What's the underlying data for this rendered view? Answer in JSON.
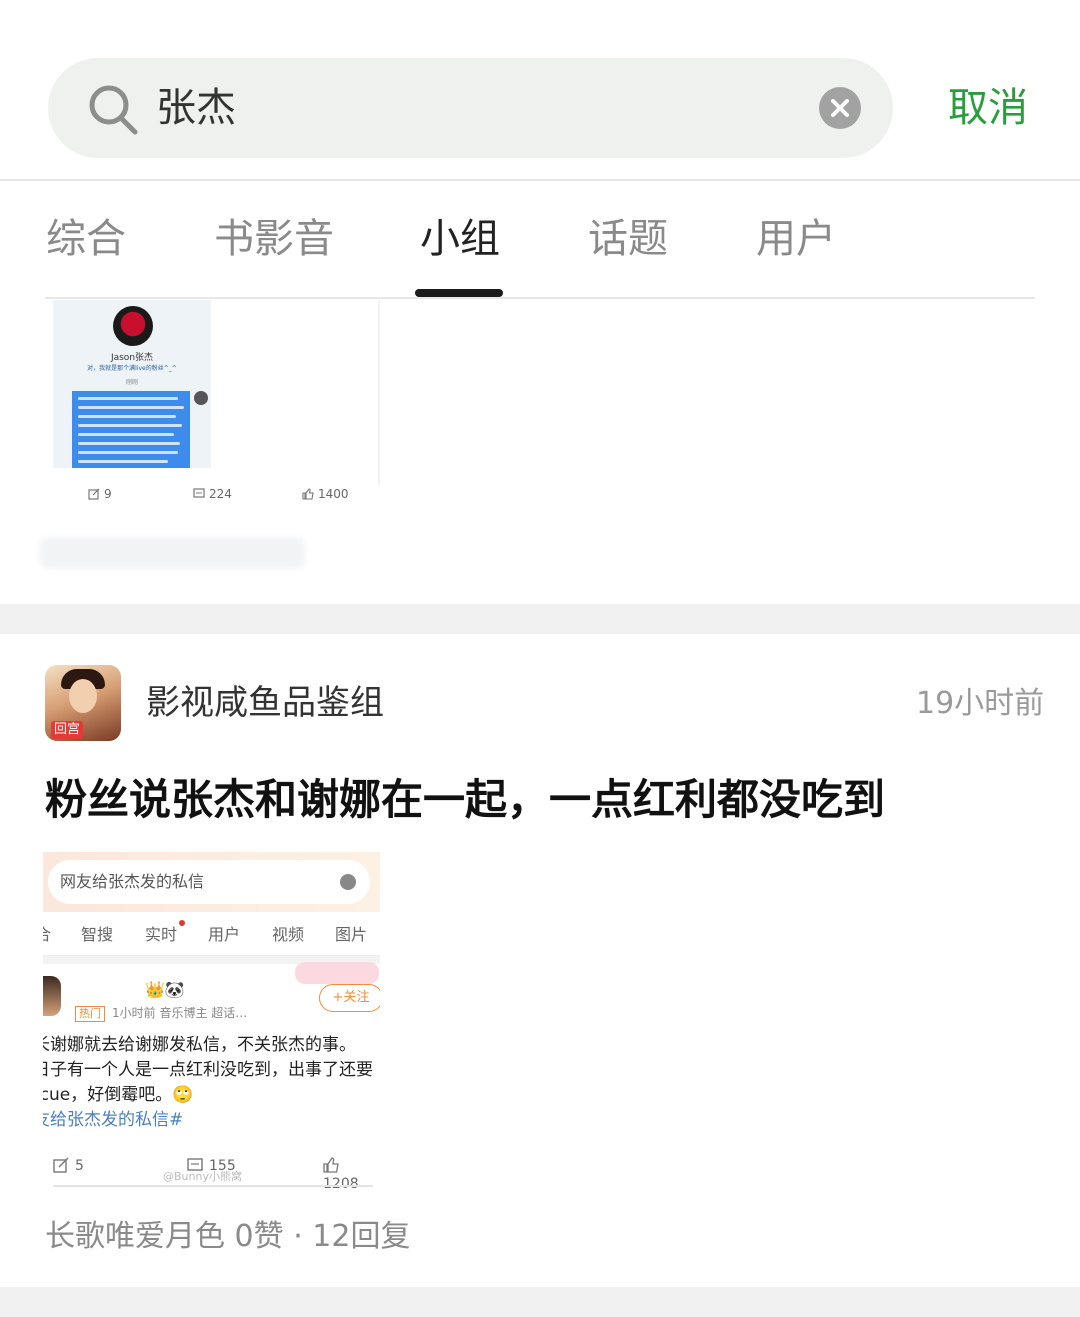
{
  "search": {
    "query": "张杰",
    "cancel_label": "取消",
    "icon": "search-icon",
    "clear_icon": "close-icon"
  },
  "tabs": [
    {
      "label": "综合",
      "active": false
    },
    {
      "label": "书影音",
      "active": false
    },
    {
      "label": "小组",
      "active": true
    },
    {
      "label": "话题",
      "active": false
    },
    {
      "label": "用户",
      "active": false
    }
  ],
  "colors": {
    "accent": "#2a9d3c",
    "search_bg": "#eef1ee",
    "tab_active": "#222222",
    "tab_inactive": "#8a8a8a"
  },
  "previous_post": {
    "thumbnail": {
      "name": "Jason张杰",
      "subtitle": "对，我就是那个满live的粉丝^_^",
      "time": "刚刚"
    },
    "stats": {
      "reposts": "9",
      "comments": "224",
      "likes": "1400"
    }
  },
  "post": {
    "group_name": "影视咸鱼品鉴组",
    "group_avatar_tag": "回宫",
    "time": "19小时前",
    "title": "粉丝说张杰和谢娜在一起，一点红利都没吃到",
    "screenshot": {
      "search_text": "网友给张杰发的私信",
      "tabs": [
        "合",
        "智搜",
        "实时",
        "用户",
        "视频",
        "图片"
      ],
      "crown": "👑🐼",
      "follow_label": "+关注",
      "hot_badge": "热门",
      "meta": "1小时前  音乐博主 超话…",
      "lines": [
        "长谢娜就去给谢娜发私信，不关张杰的事。",
        "日子有一个人是一点红利没吃到，出事了还要",
        "]cue，好倒霉吧。🙄",
        "友给张杰发的私信#"
      ],
      "stats": {
        "reposts": "5",
        "comments": "155",
        "likes": "1208"
      },
      "watermark": "@Bunny小熊窝"
    },
    "author": "长歌唯爱月色",
    "likes": "0赞",
    "separator": "·",
    "replies": "12回复"
  }
}
